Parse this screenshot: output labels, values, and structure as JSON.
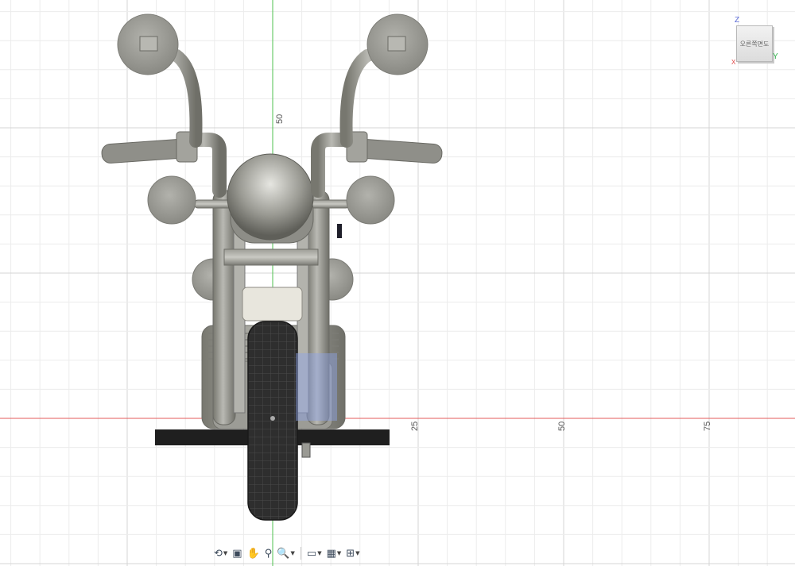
{
  "viewport": {
    "ruler": {
      "vertical_label": "50",
      "horizontal_labels": [
        "25",
        "50",
        "75"
      ]
    }
  },
  "viewcube": {
    "face_label": "오른쪽면도",
    "axis_z": "Z",
    "axis_y": "Y",
    "axis_x": "X",
    "colors": {
      "z": "#5b6bd6",
      "y": "#2fb24a",
      "x": "#e04040"
    }
  },
  "toolbar": {
    "items": [
      {
        "name": "orbit-icon",
        "has_menu": true
      },
      {
        "name": "look-at-icon",
        "has_menu": false
      },
      {
        "name": "pan-icon",
        "has_menu": false
      },
      {
        "name": "zoom-icon",
        "has_menu": false
      },
      {
        "name": "fit-icon",
        "has_menu": true
      },
      {
        "name": "display-settings-icon",
        "has_menu": true
      },
      {
        "name": "grid-settings-icon",
        "has_menu": true
      },
      {
        "name": "viewports-icon",
        "has_menu": true
      }
    ]
  },
  "colors": {
    "grid_minor": "#ececec",
    "grid_major": "#d4d4d4",
    "axis_red": "#e35b5b",
    "axis_green": "#4fc24f",
    "model_gray": "#8f8f8a",
    "tire_black": "#2c2c2c",
    "highlight_blue": "#8fa4e8"
  }
}
